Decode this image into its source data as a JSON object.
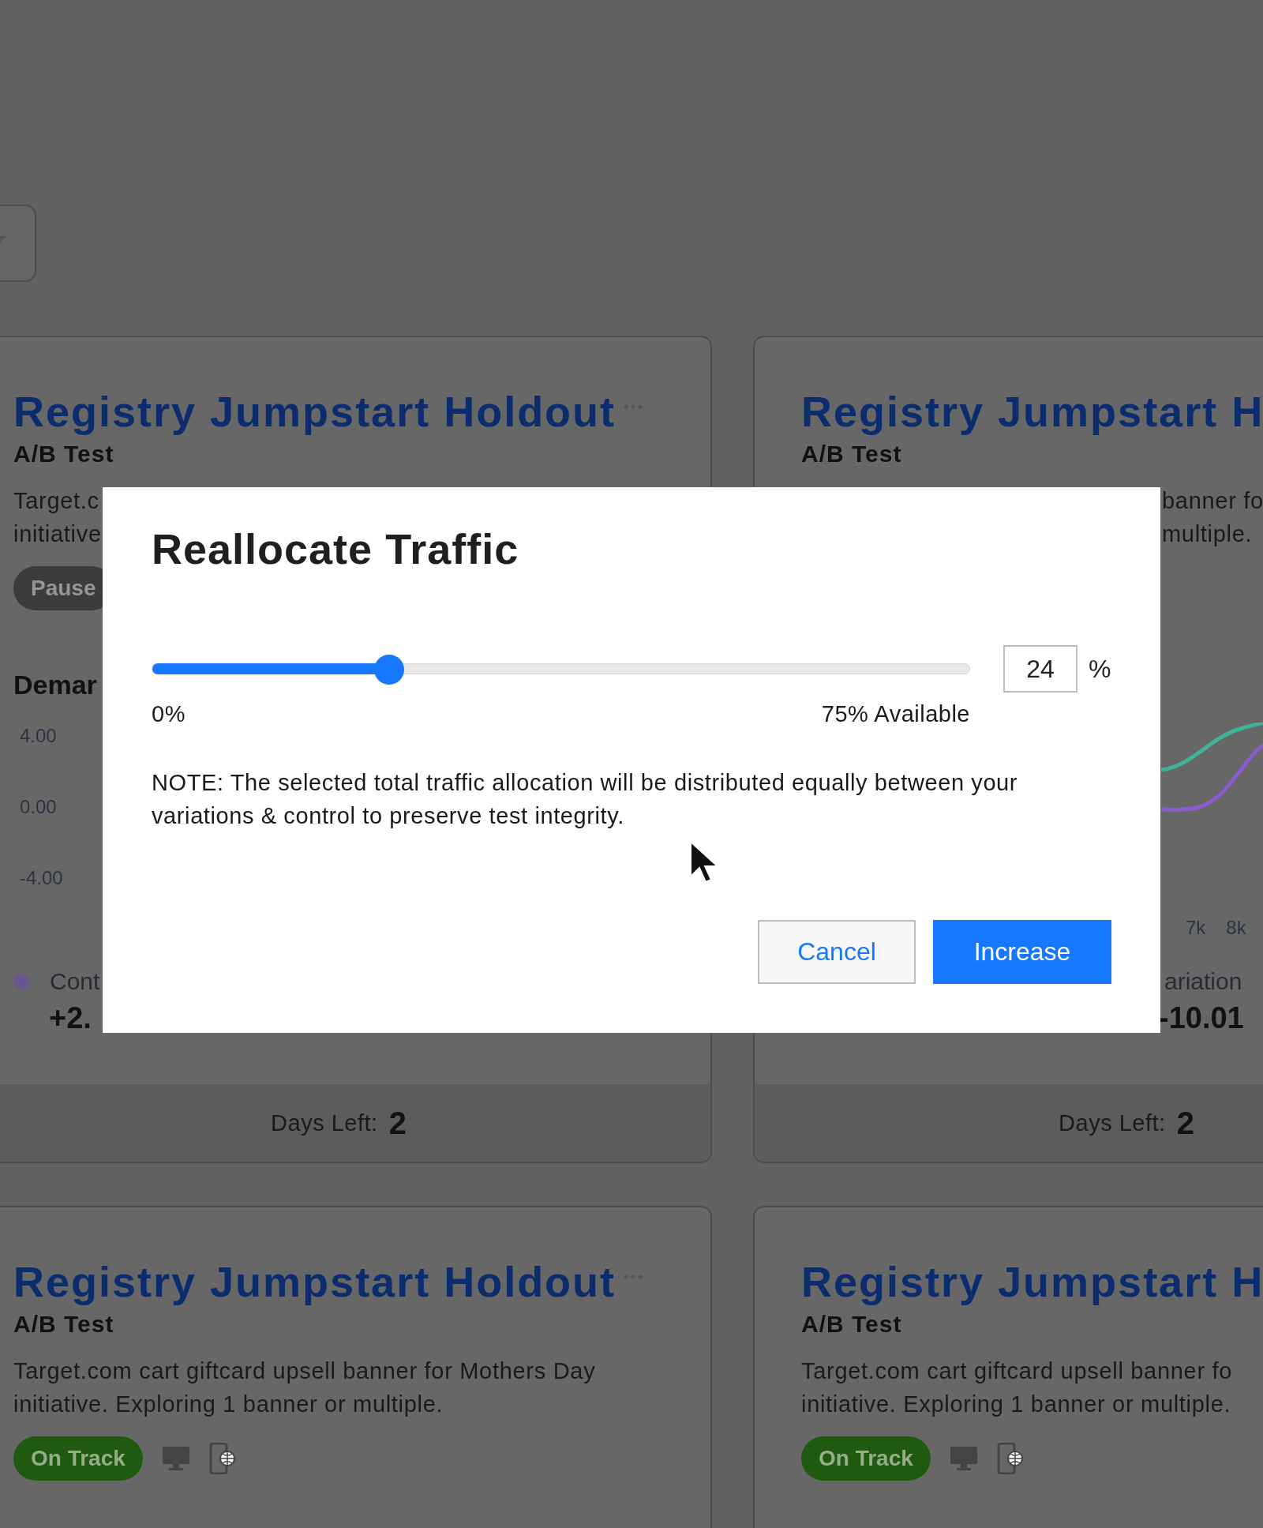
{
  "top_cards": [
    {
      "title": "Registry Jumpstart Holdout",
      "menu": true,
      "type": "A/B Test",
      "description_lines": [
        "Target.c",
        "initiative"
      ],
      "status": {
        "label": "Pause",
        "kind": "paused"
      },
      "section_title": "Demar",
      "y_ticks": [
        "4.00",
        "0.00",
        "-4.00"
      ],
      "legend": {
        "label": "Cont",
        "color": "#6a5590",
        "value": "+2."
      },
      "days_left_label": "Days Left:",
      "days_left": "2"
    },
    {
      "title": "Registry Jumpstart H",
      "type": "A/B Test",
      "description_lines": [
        "banner fo",
        "multiple."
      ],
      "x_ticks": [
        "7k",
        "8k"
      ],
      "legend": {
        "label": "ariation",
        "value": "-10.01"
      },
      "days_left_label": "Days Left:",
      "days_left": "2"
    }
  ],
  "bottom_cards": [
    {
      "title": "Registry Jumpstart Holdout",
      "menu": true,
      "type": "A/B Test",
      "description_lines": [
        "Target.com cart giftcard upsell banner for Mothers Day",
        "initiative. Exploring 1 banner or multiple."
      ],
      "status": {
        "label": "On Track",
        "kind": "on_track"
      }
    },
    {
      "title": "Registry Jumpstart H",
      "type": "A/B Test",
      "description_lines": [
        "Target.com cart giftcard upsell banner fo",
        "initiative. Exploring 1 banner or multiple."
      ],
      "status": {
        "label": "On Track",
        "kind": "on_track"
      }
    }
  ],
  "modal": {
    "title": "Reallocate Traffic",
    "slider": {
      "level": 0.29,
      "min_label": "0%",
      "max_label": "75% Available"
    },
    "input": {
      "value": "24",
      "unit": "%"
    },
    "note": "NOTE: The selected total traffic allocation will be distributed equally between your variations & control to preserve test integrity.",
    "buttons": [
      {
        "label": "Cancel",
        "kind": "secondary"
      },
      {
        "label": "Increase",
        "kind": "primary"
      }
    ]
  }
}
